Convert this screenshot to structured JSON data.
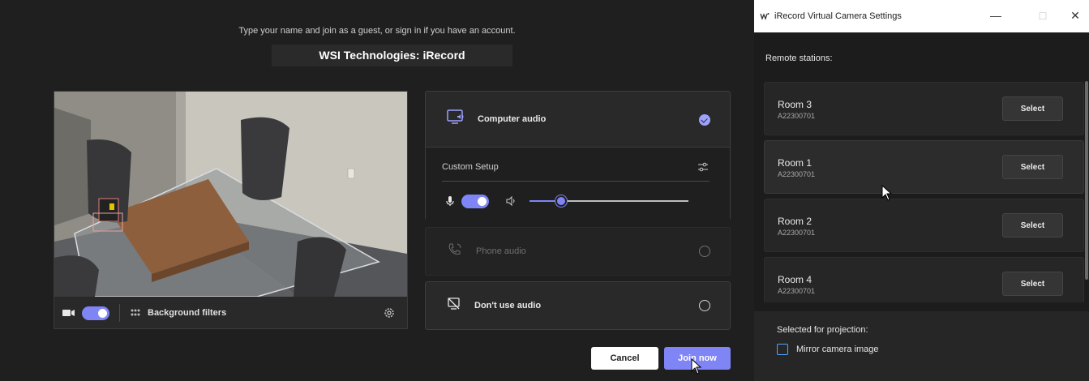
{
  "teams": {
    "subtitle": "Type your name and join as a guest, or sign in if you have an account.",
    "meeting_title": "WSI Technologies: iRecord",
    "video_bar": {
      "background_filters_label": "Background filters",
      "camera_on": true
    },
    "audio": {
      "computer_audio_label": "Computer audio",
      "custom_setup_label": "Custom Setup",
      "mic_on": true,
      "speaker_volume": 0.2,
      "phone_audio_label": "Phone audio",
      "dont_use_audio_label": "Don't use audio",
      "selected": "computer"
    },
    "buttons": {
      "cancel": "Cancel",
      "join": "Join now"
    }
  },
  "irecord": {
    "window_title": "iRecord Virtual Camera Settings",
    "remote_label": "Remote stations:",
    "stations": [
      {
        "name": "Room 3",
        "id": "A22300701",
        "action": "Select"
      },
      {
        "name": "Room 1",
        "id": "A22300701",
        "action": "Select"
      },
      {
        "name": "Room 2",
        "id": "A22300701",
        "action": "Select"
      },
      {
        "name": "Room 4",
        "id": "A22300701",
        "action": "Select"
      }
    ],
    "projection_label": "Selected for projection:",
    "mirror_label": "Mirror camera image",
    "mirror_checked": false
  },
  "colors": {
    "accent": "#7f85f5",
    "bg": "#1f1f1f",
    "card": "#292929",
    "checkbox": "#4fa6ff"
  },
  "icons": [
    "video-camera-icon",
    "background-filters-icon",
    "settings-gear-icon",
    "computer-audio-icon",
    "check-icon",
    "sliders-icon",
    "microphone-icon",
    "speaker-icon",
    "phone-audio-icon",
    "no-audio-icon",
    "minimize-icon",
    "maximize-icon",
    "close-icon",
    "mouse-cursor-icon"
  ]
}
